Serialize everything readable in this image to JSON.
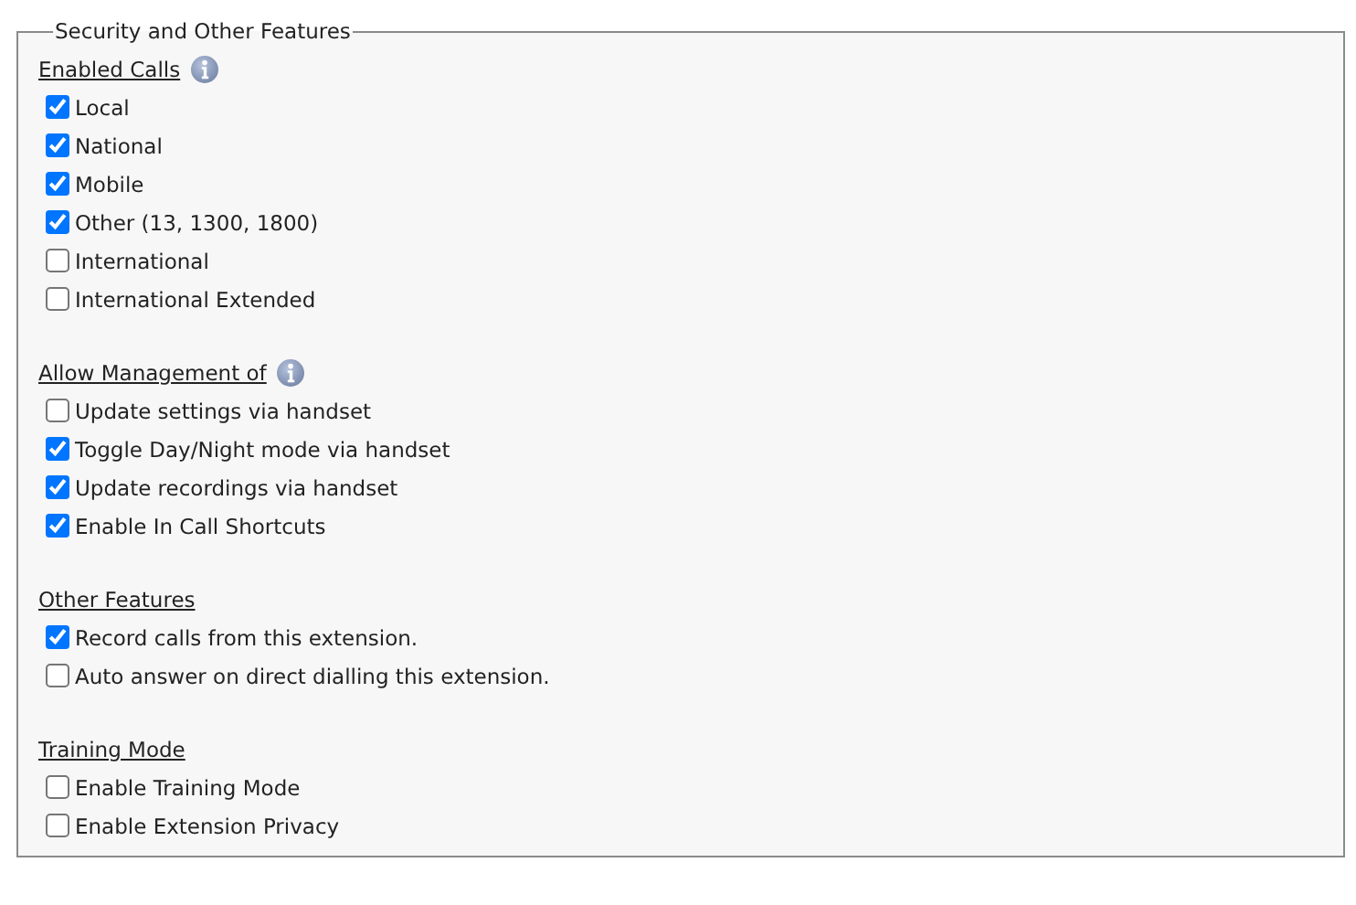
{
  "panel": {
    "title": "Security and Other Features"
  },
  "sections": [
    {
      "heading": "Enabled Calls",
      "info": true,
      "options": [
        {
          "label": "Local",
          "checked": true
        },
        {
          "label": "National",
          "checked": true
        },
        {
          "label": "Mobile",
          "checked": true
        },
        {
          "label": "Other (13, 1300, 1800)",
          "checked": true
        },
        {
          "label": "International",
          "checked": false
        },
        {
          "label": "International Extended",
          "checked": false
        }
      ]
    },
    {
      "heading": "Allow Management of",
      "info": true,
      "options": [
        {
          "label": "Update settings via handset",
          "checked": false
        },
        {
          "label": "Toggle Day/Night mode via handset",
          "checked": true
        },
        {
          "label": "Update recordings via handset",
          "checked": true
        },
        {
          "label": "Enable In Call Shortcuts",
          "checked": true
        }
      ]
    },
    {
      "heading": "Other Features",
      "info": false,
      "options": [
        {
          "label": "Record calls from this extension.",
          "checked": true
        },
        {
          "label": "Auto answer on direct dialling this extension.",
          "checked": false
        }
      ]
    },
    {
      "heading": "Training Mode",
      "info": false,
      "options": [
        {
          "label": "Enable Training Mode",
          "checked": false
        },
        {
          "label": "Enable Extension Privacy",
          "checked": false
        }
      ]
    }
  ]
}
